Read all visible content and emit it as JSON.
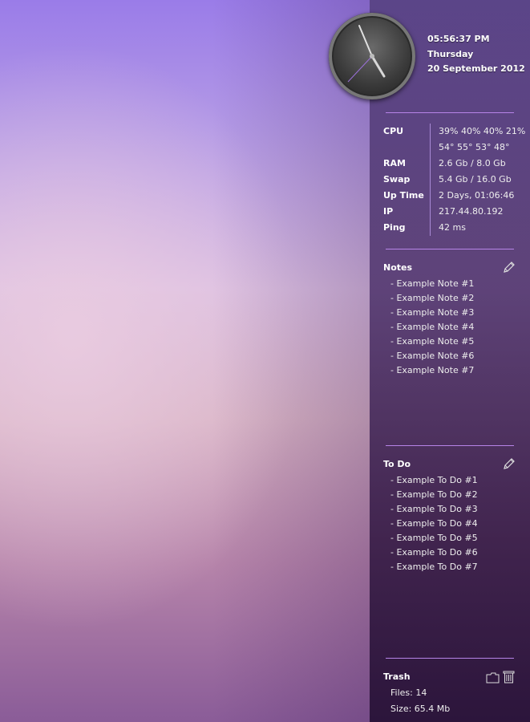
{
  "datetime": {
    "time": "05:56:37  PM",
    "weekday": "Thursday",
    "date": "20  September  2012"
  },
  "system": {
    "cpu_label": "CPU",
    "cpu_values": "39%  40%  40%  21%",
    "cpu_temps": "54°  55°  53°  48°",
    "ram_label": "RAM",
    "ram_value": "2.6  Gb  /  8.0  Gb",
    "swap_label": "Swap",
    "swap_value": "5.4  Gb  /  16.0  Gb",
    "uptime_label": "Up  Time",
    "uptime_value": "2  Days,  01:06:46",
    "ip_label": "IP",
    "ip_value": "217.44.80.192",
    "ping_label": "Ping",
    "ping_value": "42  ms"
  },
  "notes": {
    "title": "Notes",
    "edit_icon": "pencil-icon",
    "items": [
      "-  Example  Note  #1",
      "-  Example  Note  #2",
      "-  Example  Note  #3",
      "-  Example  Note  #4",
      "-  Example  Note  #5",
      "-  Example  Note  #6",
      "-  Example  Note  #7"
    ]
  },
  "todo": {
    "title": "To  Do",
    "edit_icon": "pencil-icon",
    "items": [
      "-  Example  To  Do  #1",
      "-  Example  To  Do  #2",
      "-  Example  To  Do  #3",
      "-  Example  To  Do  #4",
      "-  Example  To  Do  #5",
      "-  Example  To  Do  #6",
      "-  Example  To  Do  #7"
    ]
  },
  "trash": {
    "title": "Trash",
    "files": "Files:  14",
    "size": "Size:  65.4  Mb",
    "folder_icon": "folder-icon",
    "trash_icon": "trash-icon"
  },
  "colors": {
    "accent": "#b784e8",
    "sidebar_top": "#50387a",
    "sidebar_bottom": "#281237"
  }
}
